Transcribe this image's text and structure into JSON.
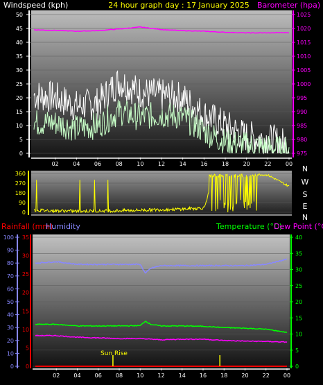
{
  "header": {
    "wind_label": "Windspeed (kph)",
    "title": "24 hour graph day : 17 January 2025",
    "baro_label": "Barometer (hpa)"
  },
  "footer_labels": {
    "rain_label": "Rainfall (mm)",
    "hum_label": "Humidity",
    "temp_label": "Temperature (°C)",
    "dew_label": "Dew Point (°C)"
  },
  "compass": [
    "N",
    "W",
    "S",
    "E",
    "N"
  ],
  "annotation": "Sun Rise",
  "colors": {
    "wind_gust": "#ffffff",
    "wind_avg": "#c8ffc8",
    "barometer": "#ff00ff",
    "direction": "#ffff00",
    "humidity": "#8888ff",
    "temperature": "#00ff00",
    "dewpoint": "#ff00ff",
    "rain": "#ff0000",
    "solar": "#ffff00"
  },
  "chart_data": [
    {
      "type": "line",
      "name": "wind-baro",
      "x_ticks": [
        "02",
        "04",
        "06",
        "08",
        "10",
        "12",
        "14",
        "16",
        "18",
        "20",
        "22",
        "00"
      ],
      "ylim_left": [
        0,
        50
      ],
      "yticks_left": [
        0,
        5,
        10,
        15,
        20,
        25,
        30,
        35,
        40,
        45,
        50
      ],
      "ylim_right": [
        975,
        1025
      ],
      "yticks_right": [
        975,
        980,
        985,
        990,
        995,
        1000,
        1005,
        1010,
        1015,
        1020,
        1025
      ],
      "series": [
        {
          "axis": "left",
          "hours": [
            0,
            2,
            4,
            6,
            8,
            10,
            12,
            14,
            16,
            18,
            20,
            22,
            24
          ],
          "values": [
            21,
            20,
            17,
            18,
            26,
            22,
            21,
            20,
            14,
            10,
            6,
            5,
            3
          ]
        },
        {
          "axis": "left",
          "hours": [
            0,
            2,
            4,
            6,
            8,
            10,
            12,
            14,
            16,
            18,
            20,
            22,
            24
          ],
          "values": [
            11,
            11,
            9,
            10,
            15,
            13,
            14,
            13,
            8,
            4,
            3,
            2,
            1
          ]
        },
        {
          "axis": "right",
          "hours": [
            0,
            2,
            4,
            6,
            8,
            10,
            12,
            14,
            16,
            18,
            20,
            22,
            24
          ],
          "values": [
            1019.5,
            1019.3,
            1019,
            1019.2,
            1019.8,
            1020.5,
            1019.6,
            1019.2,
            1019,
            1018.6,
            1018.4,
            1018.4,
            1018.5
          ]
        }
      ]
    },
    {
      "type": "line",
      "name": "wind-direction",
      "x_ticks": [],
      "ylim": [
        0,
        360
      ],
      "yticks": [
        0,
        90,
        180,
        270,
        360
      ],
      "series": [
        {
          "hours": [
            0,
            2,
            4,
            6,
            8,
            10,
            12,
            14,
            16,
            17,
            18,
            20,
            22,
            24
          ],
          "values": [
            20,
            15,
            10,
            12,
            15,
            20,
            25,
            30,
            40,
            350,
            355,
            355,
            345,
            240
          ]
        }
      ]
    },
    {
      "type": "line",
      "name": "temp-humidity",
      "x_ticks": [
        "02",
        "04",
        "06",
        "08",
        "10",
        "12",
        "14",
        "16",
        "18",
        "20",
        "22",
        "00"
      ],
      "ylim_rain": [
        0,
        35
      ],
      "yticks_rain": [
        0,
        5,
        10,
        15,
        20,
        25,
        30,
        35
      ],
      "ylim_hum": [
        0,
        100
      ],
      "yticks_hum": [
        0,
        10,
        20,
        30,
        40,
        50,
        60,
        70,
        80,
        90,
        100
      ],
      "ylim_temp": [
        0,
        40
      ],
      "yticks_temp": [
        0,
        5,
        10,
        15,
        20,
        25,
        30,
        35,
        40
      ],
      "series": [
        {
          "axis": "hum",
          "hours": [
            0,
            2,
            4,
            6,
            8,
            10,
            10.5,
            11,
            12,
            14,
            16,
            18,
            20,
            22,
            24
          ],
          "values": [
            80,
            81,
            79,
            79,
            79,
            79,
            72,
            76,
            78,
            78,
            78,
            78,
            78,
            79,
            83
          ]
        },
        {
          "axis": "temp",
          "hours": [
            0,
            2,
            4,
            6,
            8,
            10,
            10.5,
            11,
            12,
            14,
            16,
            18,
            20,
            22,
            24
          ],
          "values": [
            13,
            13,
            12.5,
            12.5,
            12.5,
            12.6,
            14,
            13,
            12.5,
            12.5,
            12.4,
            12,
            11.8,
            11.5,
            10.5
          ]
        },
        {
          "axis": "temp",
          "hours": [
            0,
            2,
            4,
            6,
            8,
            10,
            12,
            14,
            16,
            18,
            20,
            22,
            24
          ],
          "values": [
            9.5,
            9.5,
            9,
            8.8,
            8.6,
            8.6,
            8.2,
            8.4,
            8.4,
            8,
            7.8,
            7.7,
            7.5
          ]
        },
        {
          "axis": "rain",
          "hours": [
            0,
            24
          ],
          "values": [
            0,
            0
          ]
        }
      ],
      "solar_markers_hours": [
        7.4,
        17.6
      ]
    }
  ]
}
